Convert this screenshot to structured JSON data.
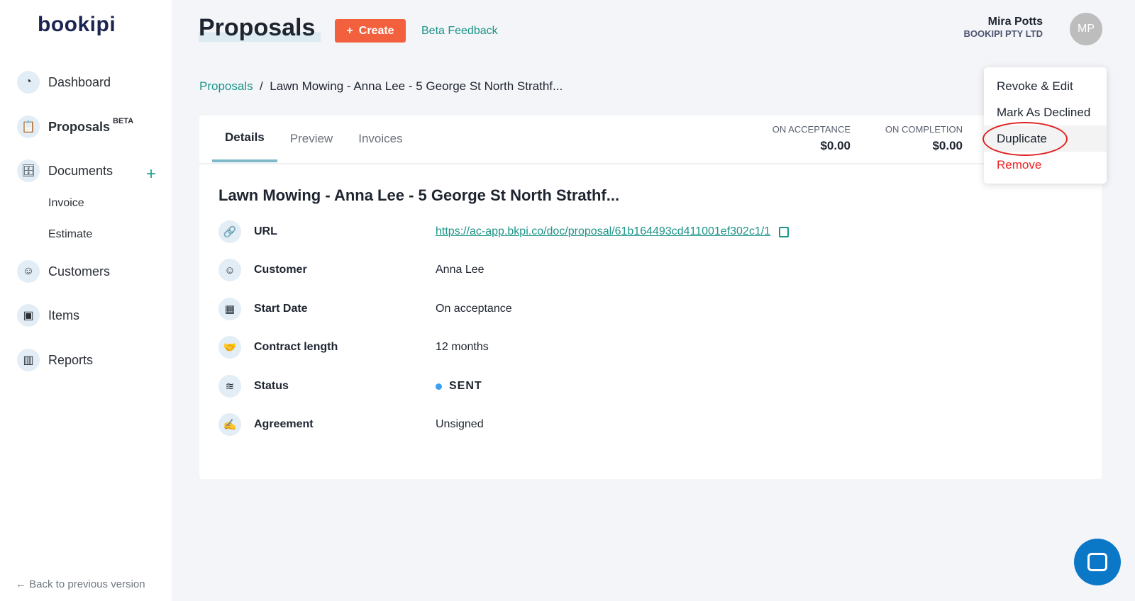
{
  "brand": "bookipi",
  "sidebar": {
    "items": [
      {
        "label": "Dashboard",
        "icon": "gauge-icon"
      },
      {
        "label": "Proposals",
        "badge": "BETA",
        "icon": "clipboard-icon"
      },
      {
        "label": "Documents",
        "icon": "tray-icon"
      },
      {
        "label": "Invoice"
      },
      {
        "label": "Estimate"
      },
      {
        "label": "Customers",
        "icon": "person-icon"
      },
      {
        "label": "Items",
        "icon": "box-icon"
      },
      {
        "label": "Reports",
        "icon": "bar-chart-icon"
      }
    ],
    "back": "Back to previous version"
  },
  "header": {
    "title": "Proposals",
    "create": "Create",
    "feedback": "Beta Feedback",
    "user_name": "Mira Potts",
    "company": "BOOKIPI PTY LTD",
    "initials": "MP"
  },
  "breadcrumb": {
    "root": "Proposals",
    "current": "Lawn Mowing - Anna Lee - 5 George St North Strathf..."
  },
  "tabs": [
    "Details",
    "Preview",
    "Invoices"
  ],
  "amounts": [
    {
      "label": "ON ACCEPTANCE",
      "value": "$0.00"
    },
    {
      "label": "ON COMPLETION",
      "value": "$0.00"
    }
  ],
  "proposal": {
    "title": "Lawn Mowing - Anna Lee - 5 George St North Strathf...",
    "rows": [
      {
        "label": "URL",
        "value": "https://ac-app.bkpi.co/doc/proposal/61b164493cd411001ef302c1/1"
      },
      {
        "label": "Customer",
        "value": "Anna Lee"
      },
      {
        "label": "Start Date",
        "value": "On acceptance"
      },
      {
        "label": "Contract length",
        "value": "12 months"
      },
      {
        "label": "Status",
        "value": "SENT"
      },
      {
        "label": "Agreement",
        "value": "Unsigned"
      }
    ]
  },
  "menu": [
    "Revoke & Edit",
    "Mark As Declined",
    "Duplicate",
    "Remove"
  ],
  "colors": {
    "accent": "#1a9487",
    "create": "#f3603d",
    "status_sent": "#3ba0f2",
    "danger": "#f02020"
  }
}
